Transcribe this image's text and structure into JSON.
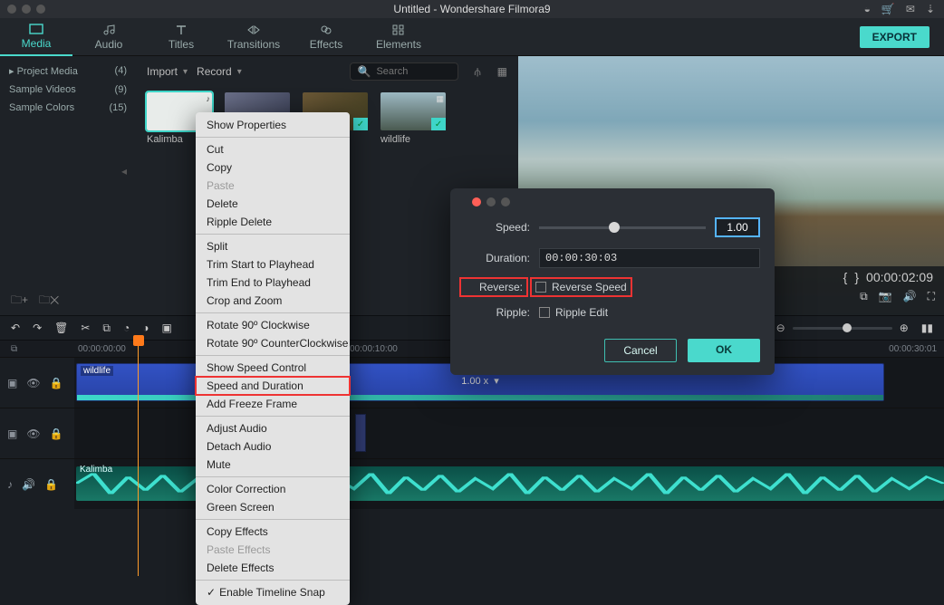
{
  "title": "Untitled - Wondershare Filmora9",
  "export": "EXPORT",
  "tabs": {
    "media": "Media",
    "audio": "Audio",
    "titles": "Titles",
    "transitions": "Transitions",
    "effects": "Effects",
    "elements": "Elements"
  },
  "sidebar": {
    "items": [
      {
        "label": "Project Media",
        "count": "(4)"
      },
      {
        "label": "Sample Videos",
        "count": "(9)"
      },
      {
        "label": "Sample Colors",
        "count": "(15)"
      }
    ]
  },
  "mediabar": {
    "import": "Import",
    "record": "Record",
    "search_ph": "Search"
  },
  "thumbs": {
    "t0": "Kalimba",
    "t3": "wildlife"
  },
  "preview": {
    "time": "00:00:02:09"
  },
  "timeline": {
    "ticks": {
      "t0": "00:00:00:00",
      "t1": "00:00:10:00",
      "t2": "00:00:30:01"
    },
    "clip_speed": "1.00 x",
    "clip_video_label": "wildlife",
    "clip_audio_label": "Kalimba"
  },
  "ctx": {
    "show_properties": "Show Properties",
    "cut": "Cut",
    "copy": "Copy",
    "paste": "Paste",
    "delete": "Delete",
    "ripple_delete": "Ripple Delete",
    "split": "Split",
    "trim_start": "Trim Start to Playhead",
    "trim_end": "Trim End to Playhead",
    "crop": "Crop and Zoom",
    "rot_cw": "Rotate 90º Clockwise",
    "rot_ccw": "Rotate 90º CounterClockwise",
    "show_speed": "Show Speed Control",
    "speed_dur": "Speed and Duration",
    "freeze": "Add Freeze Frame",
    "adj_audio": "Adjust Audio",
    "detach": "Detach Audio",
    "mute": "Mute",
    "color": "Color Correction",
    "green": "Green Screen",
    "copy_fx": "Copy Effects",
    "paste_fx": "Paste Effects",
    "del_fx": "Delete Effects",
    "snap": "Enable Timeline Snap"
  },
  "dlg": {
    "speed_l": "Speed:",
    "speed_v": "1.00",
    "dur_l": "Duration:",
    "dur_v": "00:00:30:03",
    "rev_l": "Reverse:",
    "rev_cb": "Reverse Speed",
    "rip_l": "Ripple:",
    "rip_cb": "Ripple Edit",
    "cancel": "Cancel",
    "ok": "OK"
  }
}
